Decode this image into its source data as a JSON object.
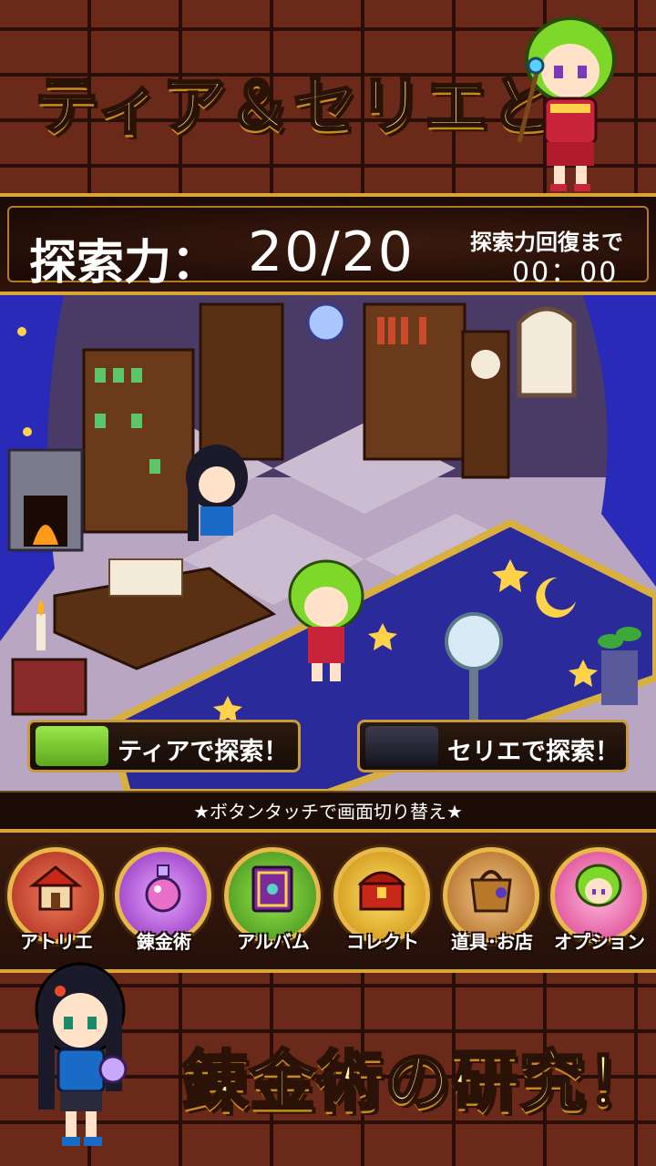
{
  "banner": {
    "top_title": "ティア＆セリエと",
    "bottom_title": "錬金術の研究！"
  },
  "stamina": {
    "label": "探索力：",
    "value": "20/20",
    "recover_label": "探索力回復まで",
    "recover_timer": "00：00"
  },
  "explore": {
    "tia_label": "ティアで探索！",
    "serie_label": "セリエで探索！"
  },
  "hint": "★ボタンタッチで画面切り替え★",
  "menu": {
    "items": [
      {
        "label": "アトリエ",
        "icon": "house-icon",
        "bg": "#d8482a"
      },
      {
        "label": "錬金術",
        "icon": "potion-icon",
        "bg": "#b44adc"
      },
      {
        "label": "アルバム",
        "icon": "book-icon",
        "bg": "#3ca83a"
      },
      {
        "label": "コレクト",
        "icon": "treasure-chest-icon",
        "bg": "#e0a016"
      },
      {
        "label": "道具･お店",
        "icon": "bag-icon",
        "bg": "#c8762a"
      },
      {
        "label": "オプション",
        "icon": "character-icon",
        "bg": "#e65aa0"
      }
    ]
  }
}
